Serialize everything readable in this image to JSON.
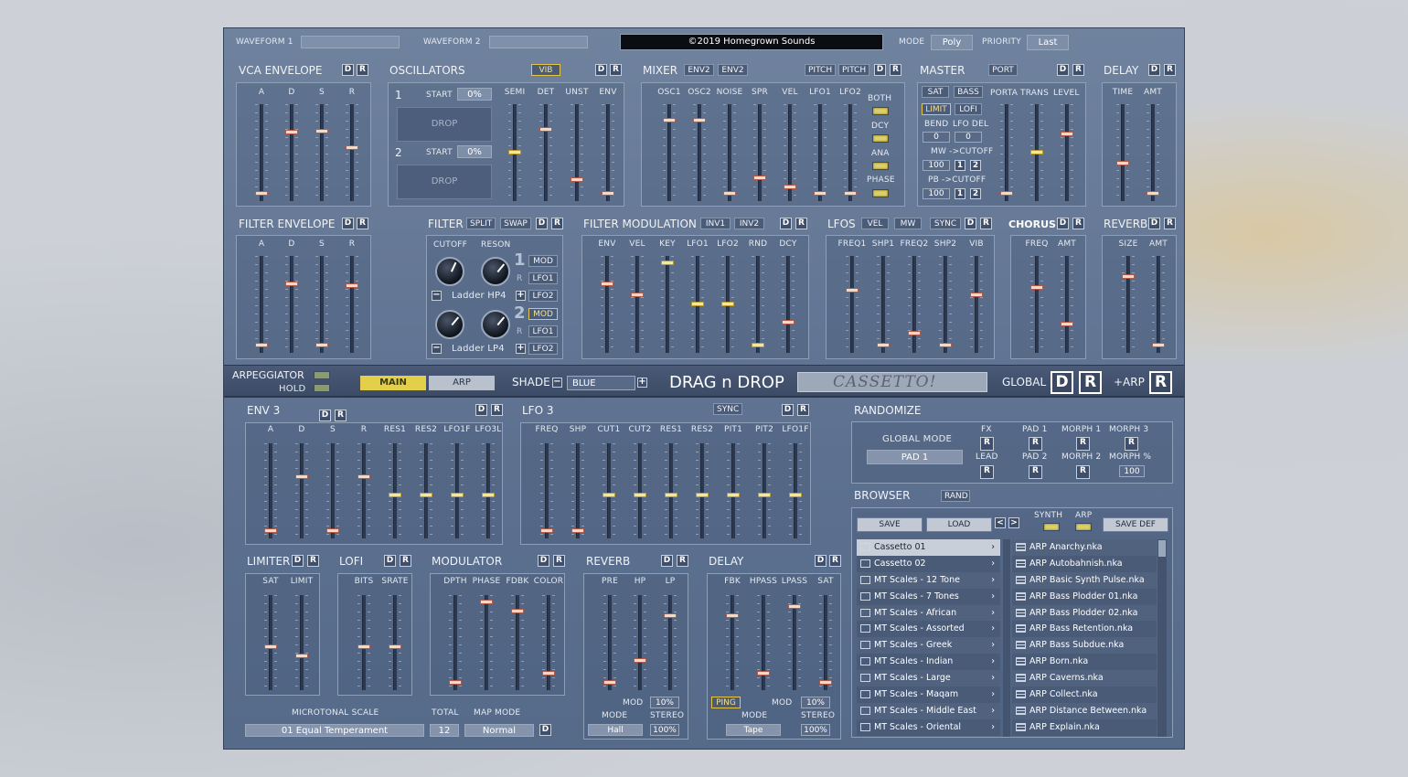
{
  "top": {
    "waveform1": "WAVEFORM 1",
    "waveform2": "WAVEFORM 2",
    "copyright": "©2019 Homegrown Sounds",
    "mode_label": "MODE",
    "mode_value": "Poly",
    "priority_label": "PRIORITY",
    "priority_value": "Last"
  },
  "common": {
    "d": "D",
    "r": "R"
  },
  "vca": {
    "title": "VCA ENVELOPE",
    "labels": [
      "A",
      "D",
      "S",
      "R"
    ],
    "levels": [
      0.05,
      0.72,
      0.73,
      0.55
    ]
  },
  "osc": {
    "title": "OSCILLATORS",
    "vib": "VIB",
    "n1": "1",
    "n2": "2",
    "start": "START",
    "start1": "0%",
    "start2": "0%",
    "drop": "DROP",
    "labels": [
      "SEMI",
      "DET",
      "UNST",
      "ENV"
    ],
    "levels": [
      0.5,
      0.75,
      0.2,
      0.05
    ]
  },
  "mixer": {
    "title": "MIXER",
    "env2a": "ENV2",
    "env2b": "ENV2",
    "pitch1": "PITCH",
    "pitch2": "PITCH",
    "labels": [
      "OSC1",
      "OSC2",
      "NOISE",
      "SPR",
      "VEL",
      "LFO1",
      "LFO2"
    ],
    "levels": [
      0.85,
      0.85,
      0.05,
      0.22,
      0.12,
      0.05,
      0.05
    ],
    "both": "BOTH",
    "dcy": "DCY",
    "ana": "ANA",
    "phase": "PHASE"
  },
  "master": {
    "title": "MASTER",
    "port": "PORT",
    "sat": "SAT",
    "bass": "BASS",
    "porta": "PORTA",
    "trans": "TRANS",
    "level": "LEVEL",
    "limit": "LIMIT",
    "lofi": "LOFI",
    "bend": "BEND",
    "lfodel": "LFO DEL",
    "bend_v": "0",
    "lfodel_v": "0",
    "mw": "MW ->CUTOFF",
    "pb": "PB ->CUTOFF",
    "mw_v": "100",
    "pb_v": "100",
    "one": "1",
    "two": "2",
    "levels": [
      0.05,
      0.5,
      0.7
    ]
  },
  "delay": {
    "title": "DELAY",
    "time": "TIME",
    "amt": "AMT",
    "levels": [
      0.38,
      0.05
    ]
  },
  "fenv": {
    "title": "FILTER ENVELOPE",
    "labels": [
      "A",
      "D",
      "S",
      "R"
    ],
    "levels": [
      0.05,
      0.72,
      0.05,
      0.7
    ]
  },
  "filter": {
    "title": "FILTER",
    "split": "SPLIT",
    "swap": "SWAP",
    "cutoff": "CUTOFF",
    "reson": "RESON",
    "big1": "1",
    "big2": "2",
    "mod": "MOD",
    "lfo1": "LFO1",
    "lfo2": "LFO2",
    "r": "R",
    "type1": "Ladder HP4",
    "type2": "Ladder LP4"
  },
  "fmod": {
    "title": "FILTER MODULATION",
    "inv1": "INV1",
    "inv2": "INV2",
    "labels": [
      "ENV",
      "VEL",
      "KEY",
      "LFO1",
      "LFO2",
      "RND",
      "DCY"
    ],
    "levels": [
      0.72,
      0.6,
      0.95,
      0.5,
      0.5,
      0.05,
      0.3
    ]
  },
  "lfos": {
    "title": "LFOS",
    "vel": "VEL",
    "mw": "MW",
    "sync": "SYNC",
    "labels": [
      "FREQ1",
      "SHP1",
      "FREQ2",
      "SHP2",
      "VIB"
    ],
    "levels": [
      0.65,
      0.05,
      0.18,
      0.05,
      0.6
    ]
  },
  "chorus": {
    "title": "CHORUS",
    "freq": "FREQ",
    "amt": "AMT",
    "levels": [
      0.68,
      0.28
    ]
  },
  "reverb_top": {
    "title": "REVERB",
    "size": "SIZE",
    "amt": "AMT",
    "levels": [
      0.8,
      0.05
    ]
  },
  "bar": {
    "arp": "ARPEGGIATOR",
    "hold": "HOLD",
    "main": "MAIN",
    "arptab": "ARP",
    "shade": "SHADE",
    "shade_value": "BLUE",
    "dnd": "DRAG n DROP",
    "preset": "CASSETTO!",
    "global": "GLOBAL",
    "plusarp": "+ARP"
  },
  "env3": {
    "title": "ENV 3",
    "labels": [
      "A",
      "D",
      "S",
      "R",
      "RES1",
      "RES2",
      "LFO1F",
      "LFO3L"
    ],
    "levels": [
      0.05,
      0.65,
      0.05,
      0.65,
      0.45,
      0.45,
      0.45,
      0.45
    ]
  },
  "lfo3": {
    "title": "LFO 3",
    "sync": "SYNC",
    "labels": [
      "FREQ",
      "SHP",
      "CUT1",
      "CUT2",
      "RES1",
      "RES2",
      "PIT1",
      "PIT2",
      "LFO1F"
    ],
    "levels": [
      0.05,
      0.05,
      0.45,
      0.45,
      0.45,
      0.45,
      0.45,
      0.45,
      0.45
    ]
  },
  "randomize": {
    "title": "RANDOMIZE",
    "global_mode": "GLOBAL MODE",
    "pad1_value": "PAD 1",
    "fx": "FX",
    "lead": "LEAD",
    "pad1": "PAD 1",
    "pad2": "PAD 2",
    "morph1": "MORPH 1",
    "morph2": "MORPH 2",
    "morph3": "MORPH 3",
    "morphpct": "MORPH %",
    "morphpct_v": "100"
  },
  "browser": {
    "title": "BROWSER",
    "rand": "RAND",
    "save": "SAVE",
    "load": "LOAD",
    "prev": "<",
    "next": ">",
    "synth": "SYNTH",
    "arp": "ARP",
    "savedef": "SAVE DEF",
    "folders": [
      "Cassetto 01",
      "Cassetto 02",
      "MT Scales - 12 Tone",
      "MT Scales - 7 Tones",
      "MT Scales - African",
      "MT Scales - Assorted",
      "MT Scales - Greek",
      "MT Scales - Indian",
      "MT Scales - Large",
      "MT Scales - Maqam",
      "MT Scales - Middle East",
      "MT Scales - Oriental"
    ],
    "files": [
      "ARP Anarchy.nka",
      "ARP Autobahnish.nka",
      "ARP Basic Synth Pulse.nka",
      "ARP Bass Plodder 01.nka",
      "ARP Bass Plodder 02.nka",
      "ARP Bass Retention.nka",
      "ARP Bass Subdue.nka",
      "ARP Born.nka",
      "ARP Caverns.nka",
      "ARP Collect.nka",
      "ARP Distance Between.nka",
      "ARP Explain.nka"
    ],
    "arrow": "›"
  },
  "limiter": {
    "title": "LIMITER",
    "sat": "SAT",
    "limit": "LIMIT",
    "levels": [
      0.45,
      0.35
    ]
  },
  "lofi": {
    "title": "LOFI",
    "bits": "BITS",
    "srate": "SRATE",
    "levels": [
      0.45,
      0.45
    ]
  },
  "modulator": {
    "title": "MODULATOR",
    "labels": [
      "DPTH",
      "PHASE",
      "FDBK",
      "COLOR"
    ],
    "levels": [
      0.05,
      0.95,
      0.85,
      0.15
    ]
  },
  "reverb_bot": {
    "title": "REVERB",
    "labels": [
      "PRE",
      "HP",
      "LP"
    ],
    "levels": [
      0.05,
      0.3,
      0.8
    ],
    "mod": "MOD",
    "mod_v": "10%",
    "mode": "MODE",
    "mode_v": "Hall",
    "stereo": "STEREO",
    "stereo_v": "100%"
  },
  "delay_bot": {
    "title": "DELAY",
    "labels": [
      "FBK",
      "HPASS",
      "LPASS",
      "SAT"
    ],
    "levels": [
      0.8,
      0.15,
      0.9,
      0.05
    ],
    "ping": "PING",
    "mod": "MOD",
    "mod_v": "10%",
    "mode": "MODE",
    "mode_v": "Tape",
    "stereo": "STEREO",
    "stereo_v": "100%"
  },
  "micro": {
    "scale": "MICROTONAL SCALE",
    "scale_v": "01 Equal Temperament",
    "total": "TOTAL",
    "total_v": "12",
    "mapmode": "MAP MODE",
    "mapmode_v": "Normal",
    "d": "D"
  }
}
